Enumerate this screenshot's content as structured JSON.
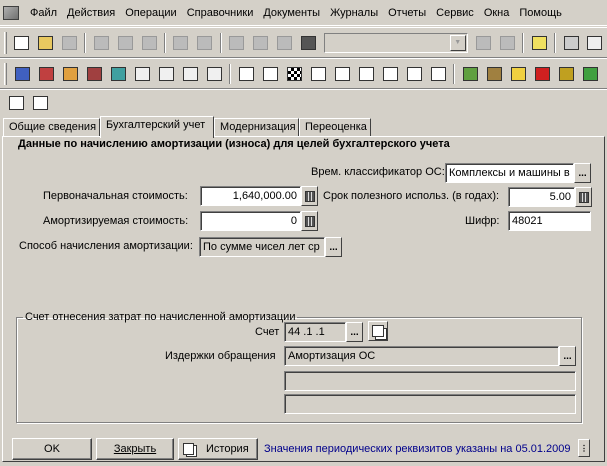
{
  "menu": [
    "Файл",
    "Действия",
    "Операции",
    "Справочники",
    "Документы",
    "Журналы",
    "Отчеты",
    "Сервис",
    "Окна",
    "Помощь"
  ],
  "tabs": [
    "Общие сведения",
    "Бухгалтерский учет",
    "Модернизация",
    "Переоценка"
  ],
  "heading": "Данные по начислению амортизации (износа) для целей бухгалтерского учета",
  "form": {
    "classifier_label": "Врем. классификатор ОС:",
    "classifier_value": "Комплексы и машины в",
    "initial_cost_label": "Первоначальная стоимость:",
    "initial_cost_value": "1,640,000.00",
    "useful_life_label": "Срок полезного использ. (в годах):",
    "useful_life_value": "5.00",
    "depreciable_cost_label": "Амортизируемая стоимость:",
    "depreciable_cost_value": "0",
    "cipher_label": "Шифр:",
    "cipher_value": "48021",
    "method_label": "Способ начисления амортизации:",
    "method_value": "По сумме чисел лет ср",
    "ellipsis": "..."
  },
  "group": {
    "legend": "Счет отнесения затрат по начисленной амортизации",
    "account_label": "Счет",
    "account_value": "44 .1 .1",
    "costs_label": "Издержки обращения",
    "costs_value": "Амортизация ОС",
    "extra1": "",
    "extra2": ""
  },
  "buttons": {
    "ok": "OK",
    "close": "Закрыть",
    "history": "История"
  },
  "status_note": "Значения периодических реквизитов указаны на 05.01.2009",
  "colors": {
    "window_bg": "#d4d0c8",
    "note_text": "#00008b"
  }
}
